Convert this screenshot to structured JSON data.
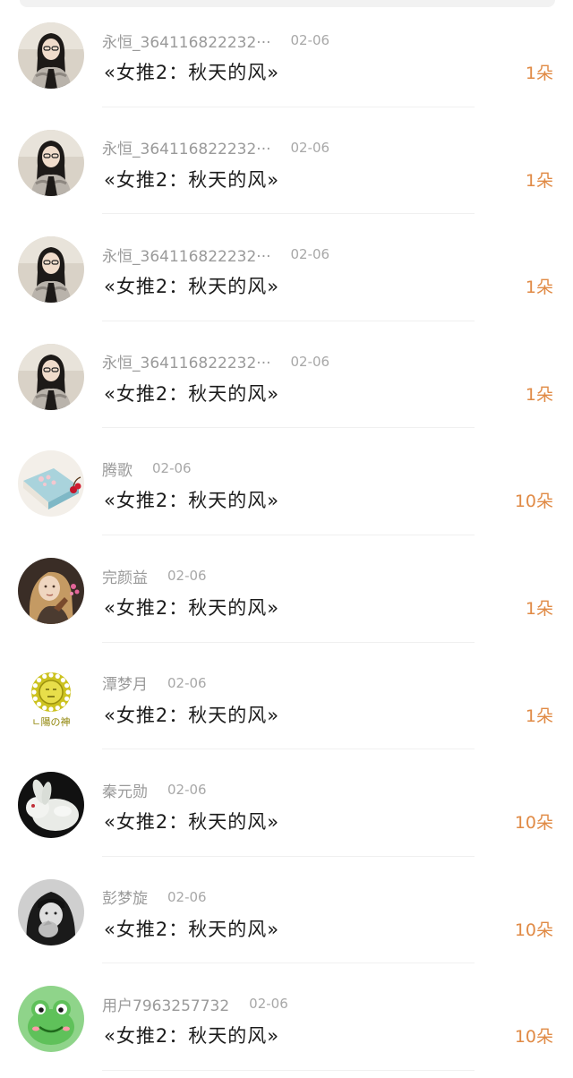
{
  "comments": [
    {
      "user": "永恒_364116822232···",
      "date": "02-06",
      "title": "«女推2：秋天的风»",
      "gift": "1朵",
      "avatar": "avatar-girl-bw-icon"
    },
    {
      "user": "永恒_364116822232···",
      "date": "02-06",
      "title": "«女推2：秋天的风»",
      "gift": "1朵",
      "avatar": "avatar-girl-bw-icon"
    },
    {
      "user": "永恒_364116822232···",
      "date": "02-06",
      "title": "«女推2：秋天的风»",
      "gift": "1朵",
      "avatar": "avatar-girl-bw-icon"
    },
    {
      "user": "永恒_364116822232···",
      "date": "02-06",
      "title": "«女推2：秋天的风»",
      "gift": "1朵",
      "avatar": "avatar-girl-bw-icon"
    },
    {
      "user": "腾歌",
      "date": "02-06",
      "title": "«女推2：秋天的风»",
      "gift": "10朵",
      "avatar": "avatar-book-cherry-icon"
    },
    {
      "user": "完颜益",
      "date": "02-06",
      "title": "«女推2：秋天的风»",
      "gift": "1朵",
      "avatar": "avatar-blonde-girl-icon"
    },
    {
      "user": "潭梦月",
      "date": "02-06",
      "title": "«女推2：秋天的风»",
      "gift": "1朵",
      "avatar": "avatar-sun-god-icon"
    },
    {
      "user": "秦元勋",
      "date": "02-06",
      "title": "«女推2：秋天的风»",
      "gift": "10朵",
      "avatar": "avatar-jade-rabbit-icon"
    },
    {
      "user": "彭梦旋",
      "date": "02-06",
      "title": "«女推2：秋天的风»",
      "gift": "10朵",
      "avatar": "avatar-girl-pointing-icon"
    },
    {
      "user": "用户7963257732",
      "date": "02-06",
      "title": "«女推2：秋天的风»",
      "gift": "10朵",
      "avatar": "avatar-green-frog-icon"
    }
  ],
  "avatar_art": {
    "avatar-sun-god-icon": {
      "caption": "ㄴ陽の神"
    }
  },
  "colors": {
    "gift": "#e08a45",
    "meta": "#9a9a9a",
    "title": "#1c1c1c"
  }
}
